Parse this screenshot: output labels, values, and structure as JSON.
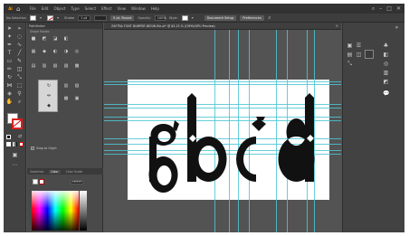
{
  "menubar": {
    "app_logo": "Ai",
    "items": [
      "File",
      "Edit",
      "Object",
      "Type",
      "Select",
      "Effect",
      "View",
      "Window",
      "Help"
    ]
  },
  "control_bar": {
    "selection_label": "No Selection",
    "stroke_label": "Stroke",
    "stroke_value": "1 pt",
    "style_button": "5 pt. Round",
    "opacity_label": "Opacity:",
    "opacity_value": "100%",
    "style_label": "Style:",
    "document_setup_button": "Document Setup",
    "preferences_button": "Preferences"
  },
  "document_tab": {
    "title": "ZAFTRA FONT BUMPER BEGIN file.ai* @ 63.23 % (CMYK/GPU Preview)"
  },
  "panel": {
    "tabs": [
      "Pathfinder"
    ],
    "sub_label": "Shape Modes:",
    "checkbox_label": "Snap to Glyph"
  },
  "color_panel": {
    "tabs": [
      "Swatches",
      "Color",
      "Color Guide"
    ],
    "active_tab": "Color",
    "hex_value": "FFFFFF"
  },
  "artwork": {
    "text": "abcd",
    "color": "#111111"
  },
  "colors": {
    "guide": "#4ec5d4",
    "stroke_red": "#dd2222"
  }
}
